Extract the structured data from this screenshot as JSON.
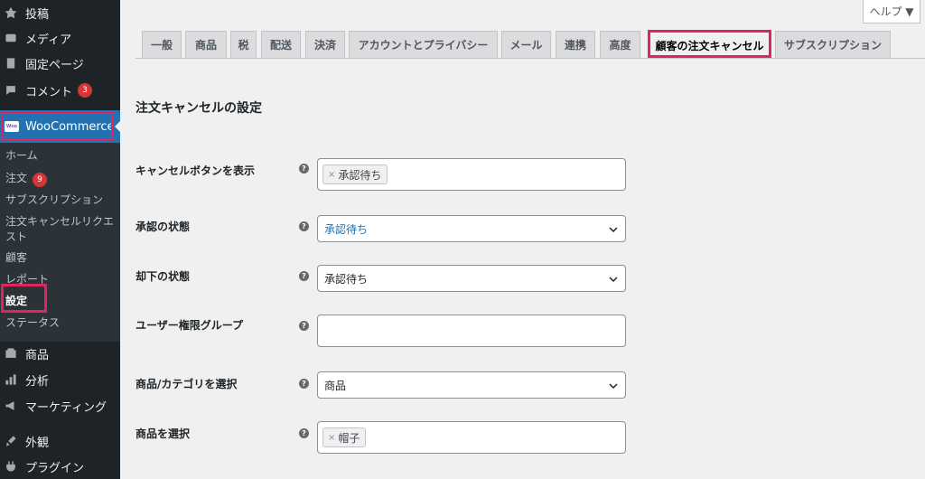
{
  "sidebar": {
    "items": [
      {
        "label": "投稿",
        "icon": "pin-icon"
      },
      {
        "label": "メディア",
        "icon": "media-icon"
      },
      {
        "label": "固定ページ",
        "icon": "page-icon"
      },
      {
        "label": "コメント",
        "icon": "comment-icon",
        "badge": "3"
      },
      {
        "label": "商品",
        "icon": "product-icon"
      },
      {
        "label": "分析",
        "icon": "analytics-icon"
      },
      {
        "label": "マーケティング",
        "icon": "megaphone-icon"
      },
      {
        "label": "外観",
        "icon": "brush-icon"
      },
      {
        "label": "プラグイン",
        "icon": "plugin-icon"
      }
    ],
    "woocommerce": {
      "label": "WooCommerce",
      "logo": "Woo"
    },
    "submenu": [
      {
        "label": "ホーム"
      },
      {
        "label": "注文",
        "badge": "9"
      },
      {
        "label": "サブスクリプション"
      },
      {
        "label": "注文キャンセルリクエスト"
      },
      {
        "label": "顧客"
      },
      {
        "label": "レポート"
      },
      {
        "label": "設定",
        "current": true
      },
      {
        "label": "ステータス"
      }
    ]
  },
  "help": {
    "label": "ヘルプ ▼"
  },
  "tabs": [
    {
      "label": "一般"
    },
    {
      "label": "商品"
    },
    {
      "label": "税"
    },
    {
      "label": "配送"
    },
    {
      "label": "決済"
    },
    {
      "label": "アカウントとプライバシー"
    },
    {
      "label": "メール"
    },
    {
      "label": "連携"
    },
    {
      "label": "高度"
    },
    {
      "label": "顧客の注文キャンセル",
      "active": true
    },
    {
      "label": "サブスクリプション"
    }
  ],
  "form": {
    "title": "注文キャンセルの設定",
    "rows": [
      {
        "label": "キャンセルボタンを表示",
        "type": "multi",
        "chips": [
          "承認待ち"
        ]
      },
      {
        "label": "承認の状態",
        "type": "select",
        "value": "承認待ち",
        "value_color": "#2271b1"
      },
      {
        "label": "却下の状態",
        "type": "select",
        "value": "承認待ち"
      },
      {
        "label": "ユーザー権限グループ",
        "type": "multi",
        "chips": []
      },
      {
        "label": "商品/カテゴリを選択",
        "type": "select",
        "value": "商品"
      },
      {
        "label": "商品を選択",
        "type": "multi",
        "chips": [
          "帽子"
        ]
      }
    ],
    "help_glyph": "?"
  },
  "colors": {
    "accent": "#2271b1",
    "highlight": "#e0245e",
    "badge": "#d63638"
  }
}
